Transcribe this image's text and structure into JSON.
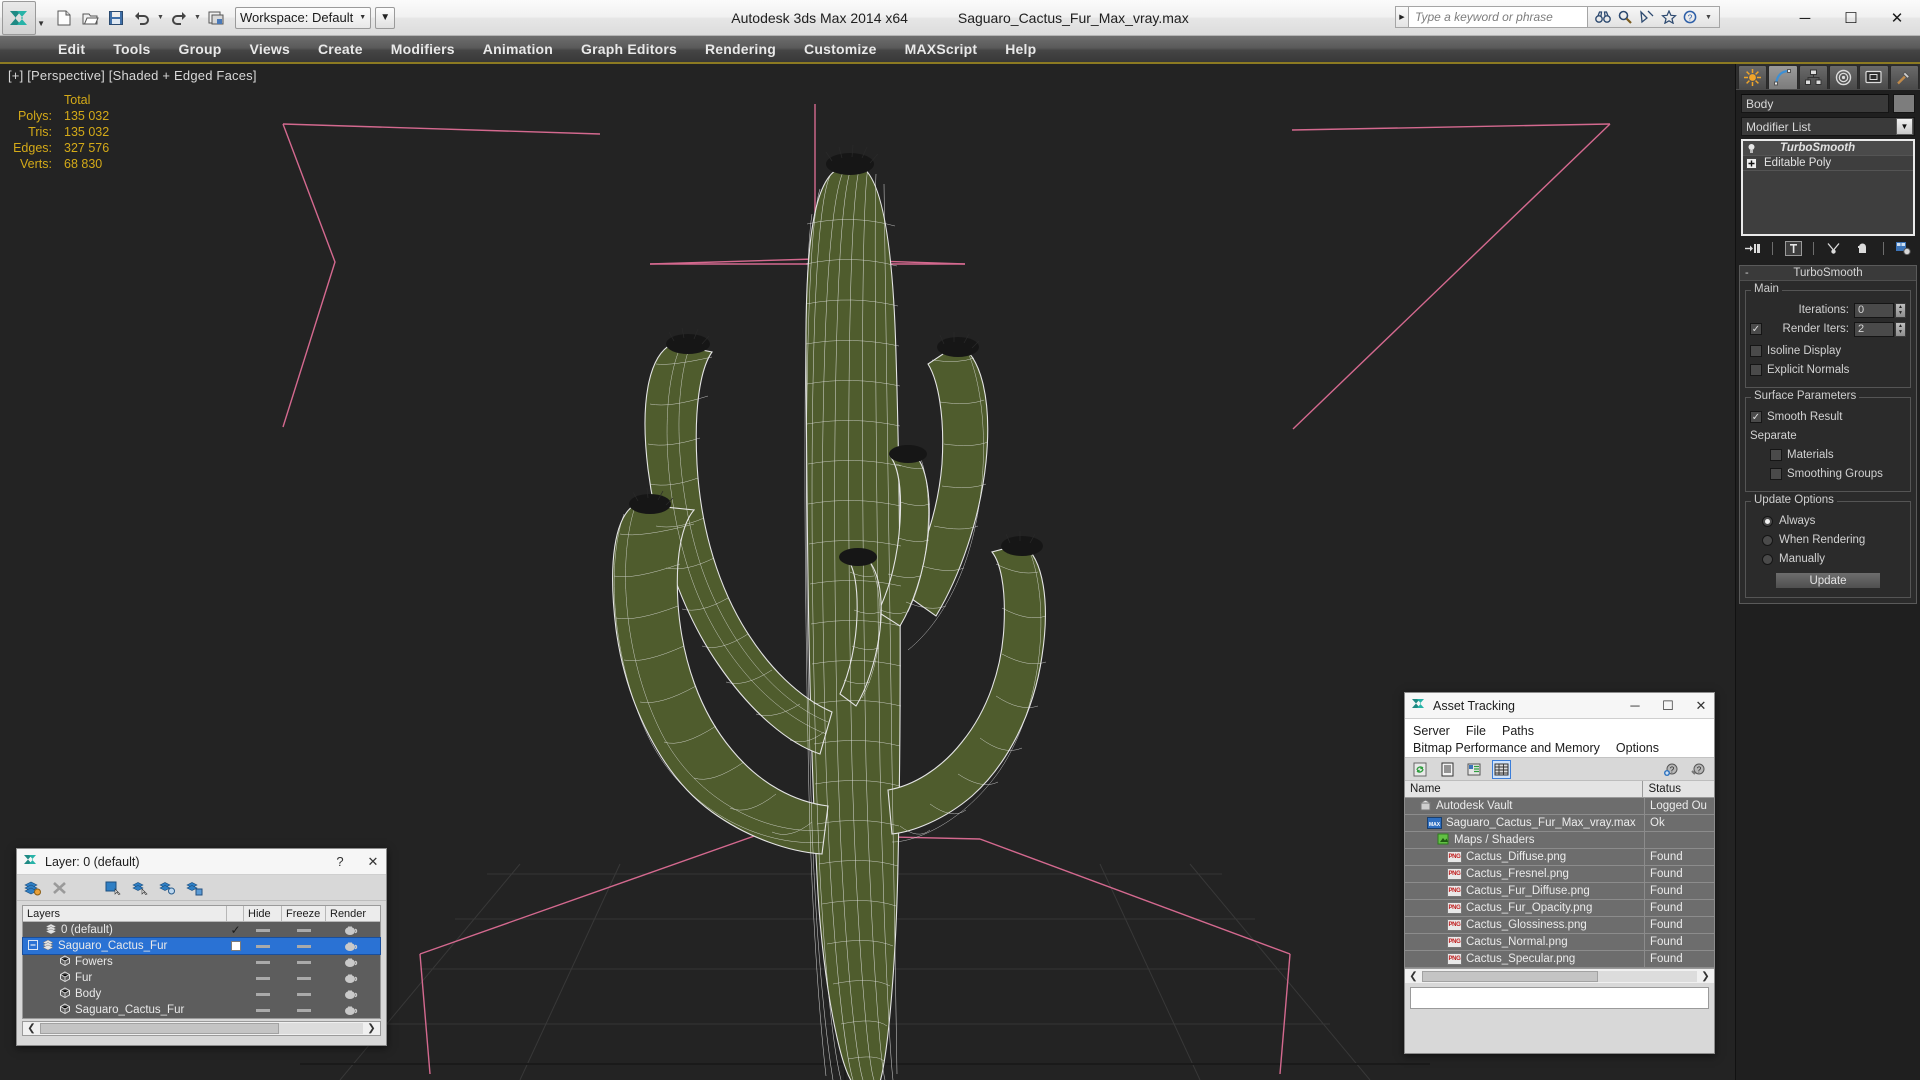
{
  "titlebar": {
    "app_title": "Autodesk 3ds Max  2014 x64",
    "file_title": "Saguaro_Cactus_Fur_Max_vray.max",
    "workspace_label": "Workspace: Default",
    "qat": [
      {
        "name": "new-file-icon",
        "label": "New"
      },
      {
        "name": "open-file-icon",
        "label": "Open"
      },
      {
        "name": "save-file-icon",
        "label": "Save"
      },
      {
        "name": "undo-icon",
        "label": "Undo"
      },
      {
        "name": "redo-icon",
        "label": "Redo"
      },
      {
        "name": "project-folder-icon",
        "label": "Set Project Folder"
      }
    ],
    "search_placeholder": "Type a keyword or phrase",
    "search_icons": [
      "binoculars-icon",
      "magnifier-icon",
      "satellite-icon",
      "star-icon",
      "help-icon"
    ],
    "window_buttons": {
      "minimize": "─",
      "maximize": "☐",
      "close": "✕"
    }
  },
  "menubar": {
    "items": [
      "Edit",
      "Tools",
      "Group",
      "Views",
      "Create",
      "Modifiers",
      "Animation",
      "Graph Editors",
      "Rendering",
      "Customize",
      "MAXScript",
      "Help"
    ]
  },
  "viewport": {
    "label": "[+] [Perspective] [Shaded + Edged Faces]",
    "stats": {
      "header": "Total",
      "rows": [
        {
          "key": "Polys:",
          "value": "135 032"
        },
        {
          "key": "Tris:",
          "value": "135 032"
        },
        {
          "key": "Edges:",
          "value": "327 576"
        },
        {
          "key": "Verts:",
          "value": "68 830"
        }
      ]
    },
    "colors": {
      "background": "#232323",
      "stats_text": "#d4aa18",
      "helper_pink": "#d4698f",
      "wire_white": "#e8e8e8",
      "mesh_green": "#5c6b33"
    }
  },
  "command_panel": {
    "tabs": [
      {
        "name": "create-tab",
        "icon": "star-burst-icon",
        "active": false
      },
      {
        "name": "modify-tab",
        "icon": "curve-icon",
        "active": true
      },
      {
        "name": "hierarchy-tab",
        "icon": "hierarchy-icon",
        "active": false
      },
      {
        "name": "motion-tab",
        "icon": "wheel-icon",
        "active": false
      },
      {
        "name": "display-tab",
        "icon": "monitor-icon",
        "active": false
      },
      {
        "name": "utilities-tab",
        "icon": "hammer-icon",
        "active": false
      }
    ],
    "object_name": "Body",
    "modifier_list_label": "Modifier List",
    "stack": [
      {
        "label": "TurboSmooth",
        "italic": true,
        "selected": true
      },
      {
        "label": "Editable Poly",
        "italic": false,
        "selected": false
      }
    ],
    "rollout": {
      "title": "TurboSmooth",
      "groups": [
        {
          "title": "Main",
          "iterations_label": "Iterations:",
          "iterations_value": "0",
          "render_iters_label": "Render Iters:",
          "render_iters_value": "2",
          "render_iters_checked": true,
          "isoline_label": "Isoline Display",
          "isoline_checked": false,
          "explicit_label": "Explicit Normals",
          "explicit_checked": false
        },
        {
          "title": "Surface Parameters",
          "smooth_result_label": "Smooth Result",
          "smooth_result_checked": true,
          "separate_label": "Separate",
          "materials_label": "Materials",
          "materials_checked": false,
          "smoothing_groups_label": "Smoothing Groups",
          "smoothing_groups_checked": false
        },
        {
          "title": "Update Options",
          "options": [
            "Always",
            "When Rendering",
            "Manually"
          ],
          "selected_option": "Always",
          "update_button": "Update"
        }
      ]
    }
  },
  "layer_dialog": {
    "title": "Layer: 0 (default)",
    "help_btn": "?",
    "close_btn": "✕",
    "toolbar": [
      {
        "name": "create-new-layer-icon"
      },
      {
        "name": "delete-layer-icon"
      },
      {
        "name": "add-selection-to-layer-icon"
      },
      {
        "name": "select-objects-in-layer-icon"
      },
      {
        "name": "select-highlighted-layer-icon"
      },
      {
        "name": "highlight-selected-objects-layer-icon"
      },
      {
        "name": "hide-unhide-layer-icon"
      }
    ],
    "columns": [
      "Layers",
      "",
      "Hide",
      "Freeze",
      "Render"
    ],
    "rows": [
      {
        "name": "0 (default)",
        "indent": 1,
        "icon": "layer-icon",
        "current": true,
        "selected": false,
        "expandable": false
      },
      {
        "name": "Saguaro_Cactus_Fur",
        "indent": 0,
        "icon": "layer-icon",
        "current": false,
        "selected": true,
        "expandable": true
      },
      {
        "name": "Fowers",
        "indent": 2,
        "icon": "object-icon",
        "current": false,
        "selected": false,
        "expandable": false
      },
      {
        "name": "Fur",
        "indent": 2,
        "icon": "object-icon",
        "current": false,
        "selected": false,
        "expandable": false
      },
      {
        "name": "Body",
        "indent": 2,
        "icon": "object-icon",
        "current": false,
        "selected": false,
        "expandable": false
      },
      {
        "name": "Saguaro_Cactus_Fur",
        "indent": 2,
        "icon": "object-icon",
        "current": false,
        "selected": false,
        "expandable": false
      }
    ]
  },
  "asset_tracking": {
    "title": "Asset Tracking",
    "window_buttons": {
      "minimize": "─",
      "maximize": "☐",
      "close": "✕"
    },
    "menus_row1": [
      "Server",
      "File",
      "Paths"
    ],
    "menus_row2": [
      "Bitmap Performance and Memory",
      "Options"
    ],
    "toolbar": [
      {
        "name": "refresh-icon",
        "active": false
      },
      {
        "name": "list-view-icon",
        "active": false
      },
      {
        "name": "detail-view-icon",
        "active": false
      },
      {
        "name": "grid-view-icon",
        "active": true
      }
    ],
    "toolbar_right": [
      {
        "name": "help-add-icon"
      },
      {
        "name": "help-query-icon"
      }
    ],
    "columns": [
      "Name",
      "Status"
    ],
    "rows": [
      {
        "name": "Autodesk Vault",
        "status": "Logged Ou",
        "icon": "vault-icon",
        "indent": 0
      },
      {
        "name": "Saguaro_Cactus_Fur_Max_vray.max",
        "status": "Ok",
        "icon": "max-file-icon",
        "indent": 1
      },
      {
        "name": "Maps / Shaders",
        "status": "",
        "icon": "maps-shaders-icon",
        "indent": 2
      },
      {
        "name": "Cactus_Diffuse.png",
        "status": "Found",
        "icon": "png-icon",
        "indent": 3
      },
      {
        "name": "Cactus_Fresnel.png",
        "status": "Found",
        "icon": "png-icon",
        "indent": 3
      },
      {
        "name": "Cactus_Fur_Diffuse.png",
        "status": "Found",
        "icon": "png-icon",
        "indent": 3
      },
      {
        "name": "Cactus_Fur_Opacity.png",
        "status": "Found",
        "icon": "png-icon",
        "indent": 3
      },
      {
        "name": "Cactus_Glossiness.png",
        "status": "Found",
        "icon": "png-icon",
        "indent": 3
      },
      {
        "name": "Cactus_Normal.png",
        "status": "Found",
        "icon": "png-icon",
        "indent": 3
      },
      {
        "name": "Cactus_Specular.png",
        "status": "Found",
        "icon": "png-icon",
        "indent": 3
      }
    ]
  }
}
